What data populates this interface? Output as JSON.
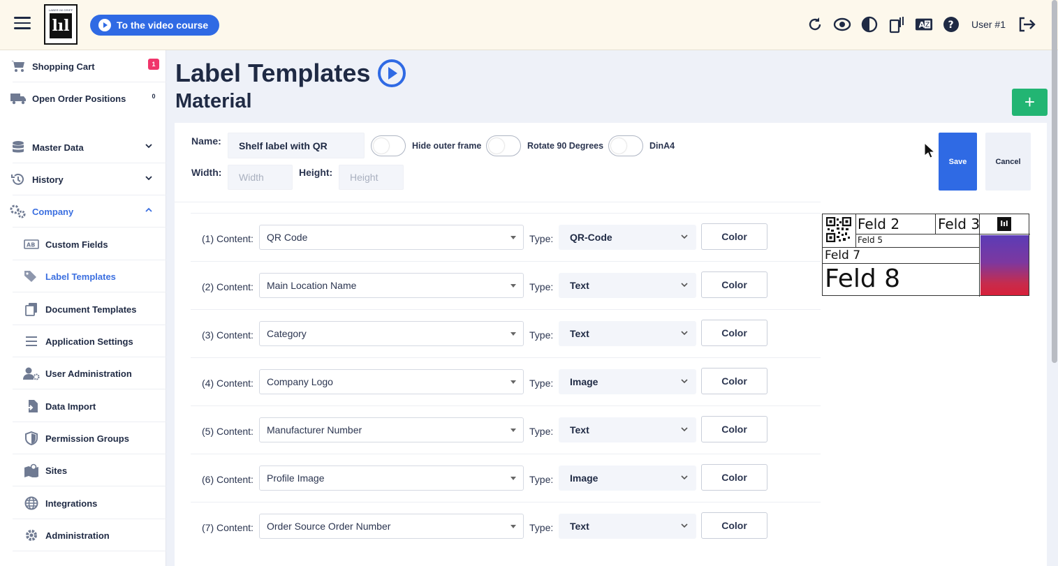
{
  "header": {
    "video_button_label": "To the video course",
    "logo_text": "LABER IM GRIFF",
    "user_label": "User #1",
    "icons": [
      "refresh-icon",
      "eye-icon",
      "contrast-icon",
      "device-icon",
      "translate-icon",
      "help-icon",
      "logout-icon"
    ]
  },
  "sidebar": {
    "cart": {
      "label": "Shopping Cart",
      "badge": "1"
    },
    "orders": {
      "label": "Open Order Positions",
      "badge": "0"
    },
    "master_data": "Master Data",
    "history": "History",
    "company": "Company",
    "sub_items": [
      "Custom Fields",
      "Label Templates",
      "Document Templates",
      "Application Settings",
      "User Administration",
      "Data Import",
      "Permission Groups",
      "Sites",
      "Integrations",
      "Administration"
    ],
    "active_color": "#3b6fe0"
  },
  "page": {
    "title": "Label Templates",
    "subtitle": "Material",
    "add_label": "+"
  },
  "form": {
    "name_label": "Name:",
    "name_value": "Shelf label with QR",
    "width_label": "Width:",
    "width_placeholder": "Width",
    "height_label": "Height:",
    "height_placeholder": "Height",
    "toggle_hide_frame": "Hide outer frame",
    "toggle_rotate": "Rotate 90 Degrees",
    "toggle_dina4": "DinA4",
    "save_label": "Save",
    "cancel_label": "Cancel",
    "save_color": "#2f6ae4"
  },
  "rows": [
    {
      "label": "(1) Content:",
      "content": "QR Code",
      "type_label": "Type:",
      "type": "QR-Code",
      "color_label": "Color"
    },
    {
      "label": "(2) Content:",
      "content": "Main Location Name",
      "type_label": "Type:",
      "type": "Text",
      "color_label": "Color"
    },
    {
      "label": "(3) Content:",
      "content": "Category",
      "type_label": "Type:",
      "type": "Text",
      "color_label": "Color"
    },
    {
      "label": "(4) Content:",
      "content": "Company Logo",
      "type_label": "Type:",
      "type": "Image",
      "color_label": "Color"
    },
    {
      "label": "(5) Content:",
      "content": "Manufacturer Number",
      "type_label": "Type:",
      "type": "Text",
      "color_label": "Color"
    },
    {
      "label": "(6) Content:",
      "content": "Profile Image",
      "type_label": "Type:",
      "type": "Image",
      "color_label": "Color"
    },
    {
      "label": "(7) Content:",
      "content": "Order Source Order Number",
      "type_label": "Type:",
      "type": "Text",
      "color_label": "Color"
    }
  ],
  "preview": {
    "field2": "Feld 2",
    "field3": "Feld 3",
    "field5": "Feld 5",
    "field7": "Feld 7",
    "field8": "Feld 8"
  }
}
